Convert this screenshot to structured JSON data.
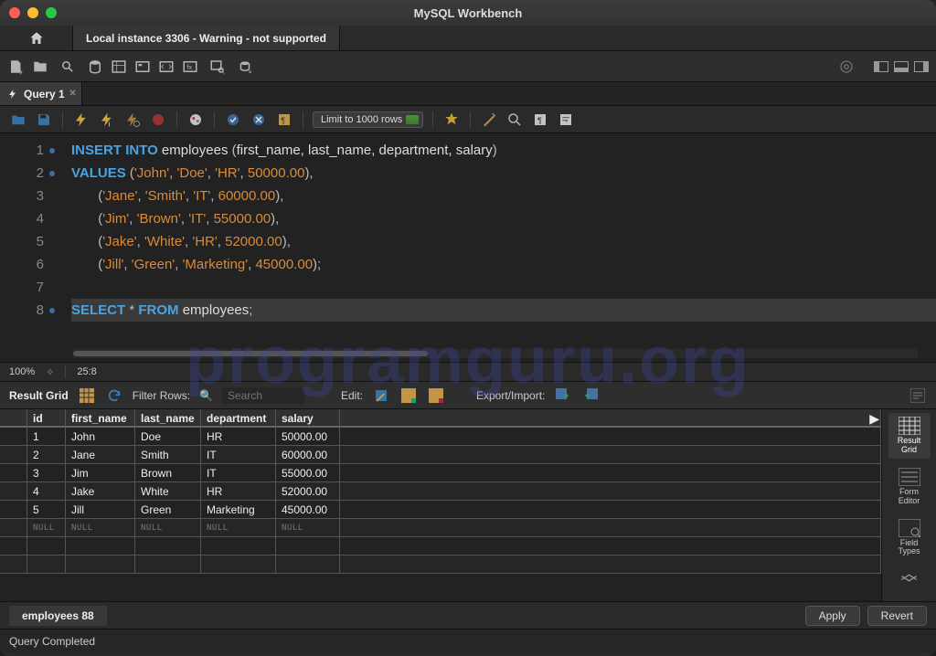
{
  "window": {
    "title": "MySQL Workbench"
  },
  "connection_tab": "Local instance 3306 - Warning - not supported",
  "query_tab": {
    "label": "Query 1"
  },
  "editor_toolbar": {
    "limit_label": "Limit to 1000 rows"
  },
  "code_lines": [
    {
      "n": 1,
      "bp": true
    },
    {
      "n": 2,
      "bp": true
    },
    {
      "n": 3
    },
    {
      "n": 4
    },
    {
      "n": 5
    },
    {
      "n": 6
    },
    {
      "n": 7
    },
    {
      "n": 8,
      "bp": true
    }
  ],
  "sql": {
    "l1_kw1": "INSERT",
    "l1_kw2": "INTO",
    "l1_tbl": "employees",
    "l1_cols": "first_name, last_name, department, salary",
    "l2_kw": "VALUES",
    "l2_v1": "'John'",
    "l2_v2": "'Doe'",
    "l2_v3": "'HR'",
    "l2_v4": "50000.00",
    "l3_v1": "'Jane'",
    "l3_v2": "'Smith'",
    "l3_v3": "'IT'",
    "l3_v4": "60000.00",
    "l4_v1": "'Jim'",
    "l4_v2": "'Brown'",
    "l4_v3": "'IT'",
    "l4_v4": "55000.00",
    "l5_v1": "'Jake'",
    "l5_v2": "'White'",
    "l5_v3": "'HR'",
    "l5_v4": "52000.00",
    "l6_v1": "'Jill'",
    "l6_v2": "'Green'",
    "l6_v3": "'Marketing'",
    "l6_v4": "45000.00",
    "l8_kw1": "SELECT",
    "l8_star": "*",
    "l8_kw2": "FROM",
    "l8_tbl": "employees"
  },
  "editor_status": {
    "zoom": "100%",
    "pos": "25:8"
  },
  "result_toolbar": {
    "title": "Result Grid",
    "filter_label": "Filter Rows:",
    "search_placeholder": "Search",
    "edit_label": "Edit:",
    "export_label": "Export/Import:"
  },
  "columns": [
    "",
    "id",
    "first_name",
    "last_name",
    "department",
    "salary"
  ],
  "rows": [
    {
      "id": "1",
      "first_name": "John",
      "last_name": "Doe",
      "department": "HR",
      "salary": "50000.00"
    },
    {
      "id": "2",
      "first_name": "Jane",
      "last_name": "Smith",
      "department": "IT",
      "salary": "60000.00"
    },
    {
      "id": "3",
      "first_name": "Jim",
      "last_name": "Brown",
      "department": "IT",
      "salary": "55000.00"
    },
    {
      "id": "4",
      "first_name": "Jake",
      "last_name": "White",
      "department": "HR",
      "salary": "52000.00"
    },
    {
      "id": "5",
      "first_name": "Jill",
      "last_name": "Green",
      "department": "Marketing",
      "salary": "45000.00"
    }
  ],
  "null_label": "NULL",
  "side_panel": {
    "result_grid": "Result\nGrid",
    "form_editor": "Form\nEditor",
    "field_types": "Field\nTypes"
  },
  "result_bottom": {
    "tab": "employees 88",
    "apply": "Apply",
    "revert": "Revert"
  },
  "statusbar": {
    "text": "Query Completed"
  },
  "watermark": "programguru.org"
}
